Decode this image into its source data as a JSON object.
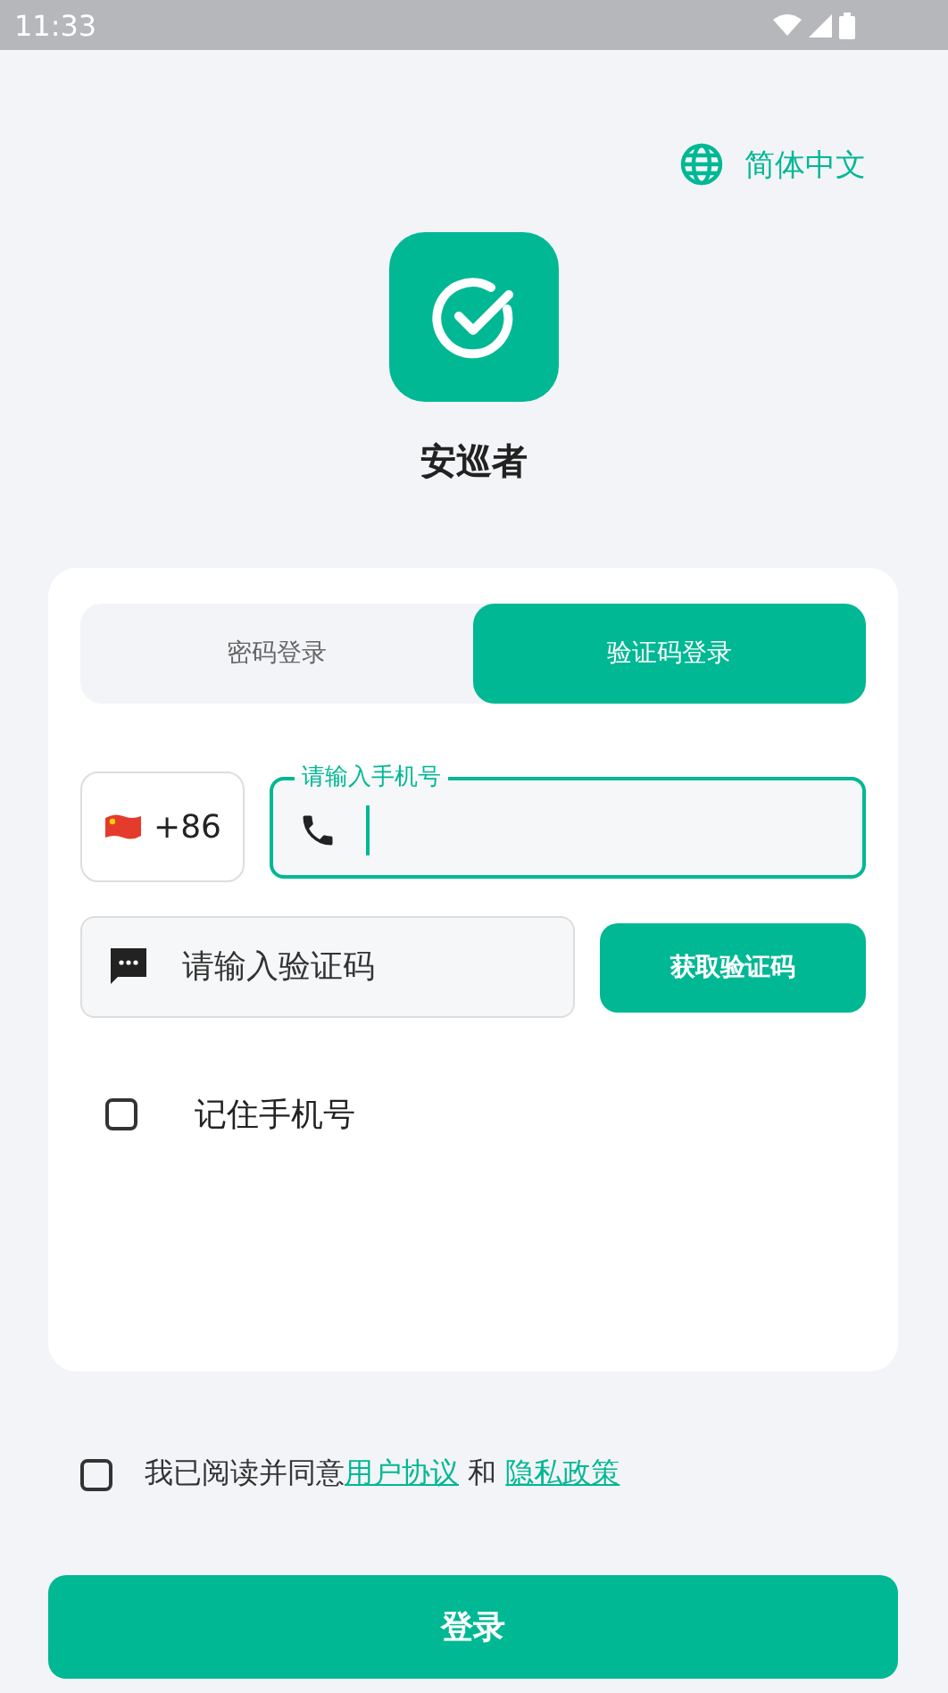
{
  "status_bar": {
    "time": "11:33"
  },
  "language": {
    "label": "简体中文"
  },
  "app": {
    "name": "安巡者"
  },
  "tabs": [
    {
      "label": "密码登录",
      "selected": false
    },
    {
      "label": "验证码登录",
      "selected": true
    }
  ],
  "phone": {
    "country_code": "+86",
    "label": "请输入手机号",
    "focused": true
  },
  "code": {
    "placeholder": "请输入验证码",
    "button": "获取验证码"
  },
  "remember": {
    "label": "记住手机号",
    "checked": false
  },
  "agreement": {
    "checked": false,
    "prefix": "我已阅读并同意",
    "link_1": "用户协议",
    "joiner": " 和 ",
    "link_2": "隐私政策"
  },
  "login_button": "登录"
}
